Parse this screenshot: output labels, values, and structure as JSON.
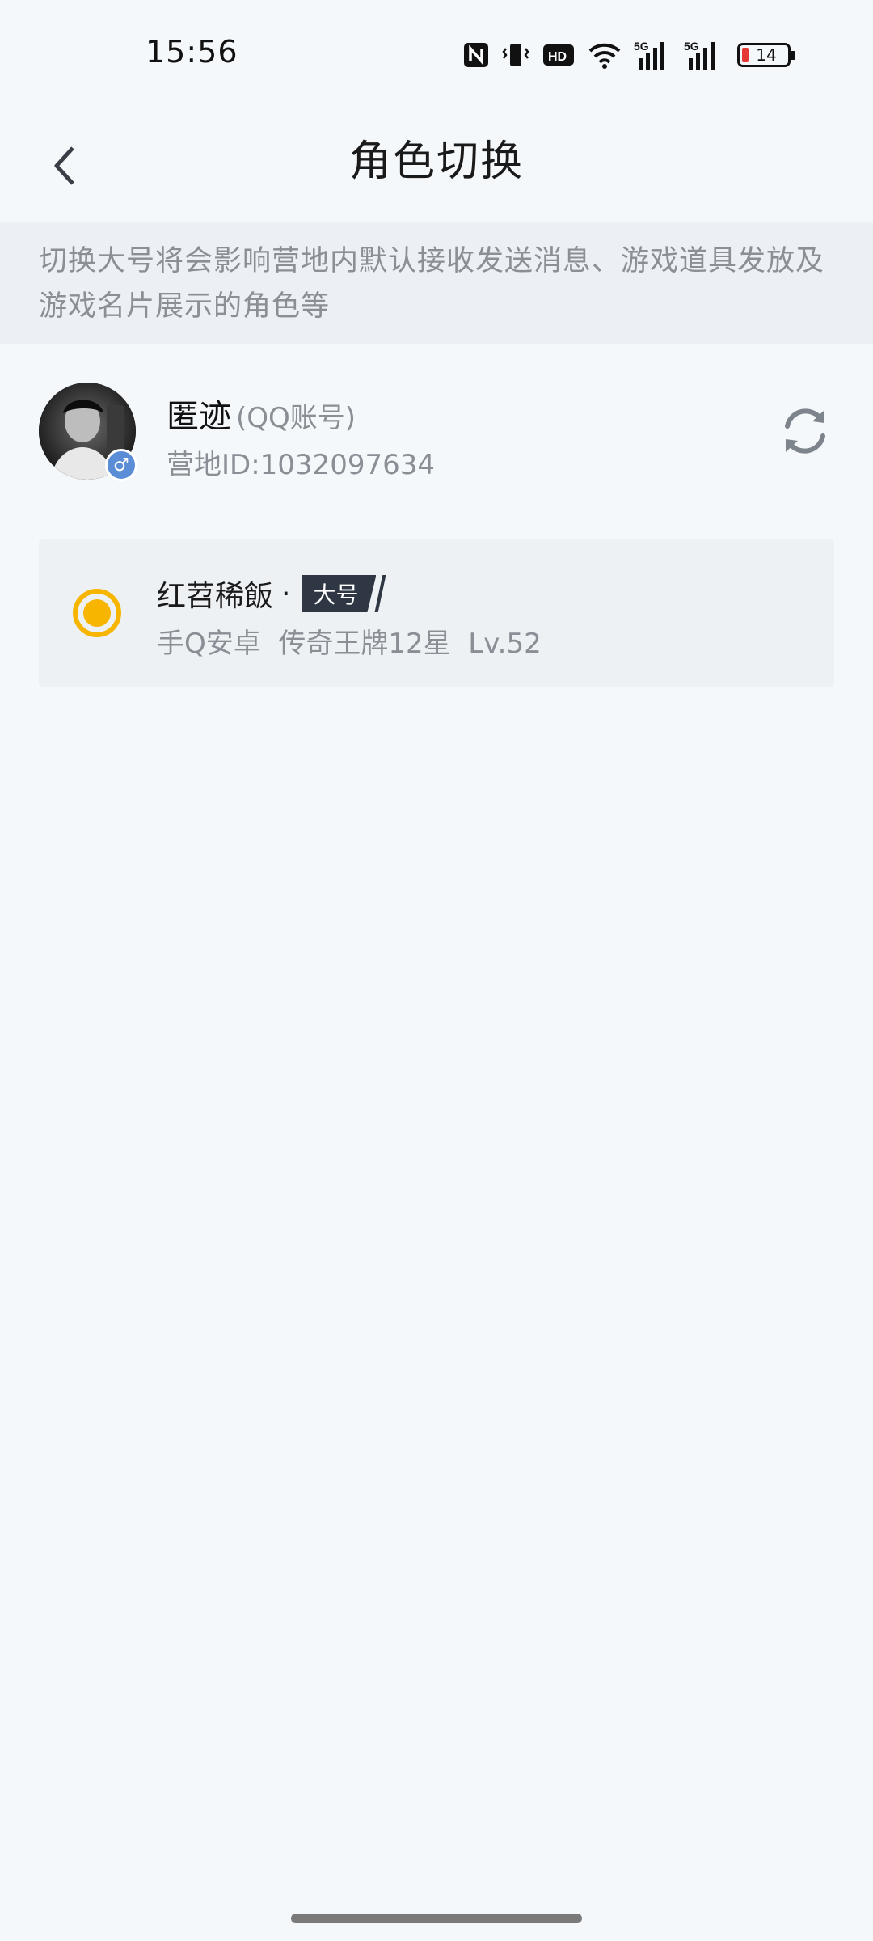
{
  "status_bar": {
    "time": "15:56",
    "battery_level": "14",
    "battery_percent": 14,
    "icons": [
      "nfc-icon",
      "vibrate-icon",
      "hd-icon",
      "wifi-icon",
      "signal-5g-icon",
      "signal-5g-icon",
      "battery-icon"
    ]
  },
  "header": {
    "title": "角色切换",
    "back_icon": "chevron-left-icon"
  },
  "notice": {
    "text": "切换大号将会影响营地内默认接收发送消息、游戏道具发放及游戏名片展示的角色等"
  },
  "account": {
    "name": "匿迹",
    "type": "(QQ账号)",
    "camp_id": "营地ID:1032097634",
    "gender_icon": "male-icon",
    "gender_symbol": "♂",
    "refresh_icon": "refresh-icon"
  },
  "roles": [
    {
      "name": "红苕稀飯",
      "separator": "·",
      "tag": "大号",
      "info": "手Q安卓  传奇王牌12星  Lv.52",
      "selected": true
    }
  ],
  "colors": {
    "accent": "#f7b500",
    "tag_bg": "#2f3745",
    "badge_blue": "#5b8dd6",
    "background": "#f5f8fb"
  }
}
